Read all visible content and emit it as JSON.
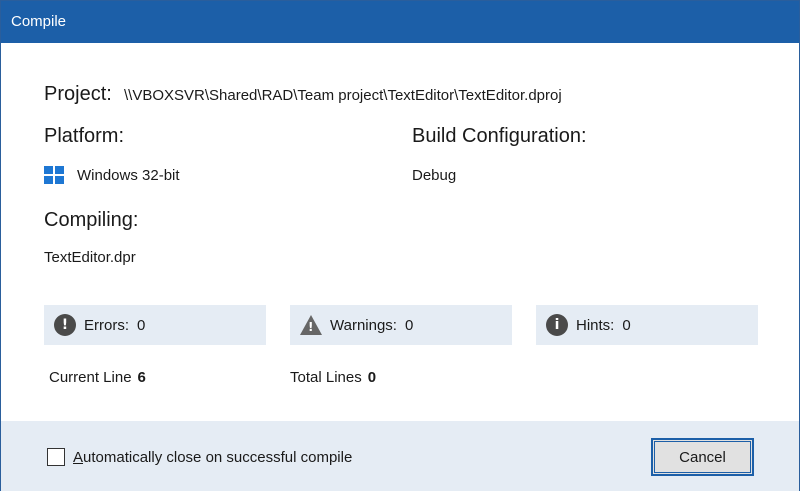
{
  "window": {
    "title": "Compile"
  },
  "project": {
    "label": "Project:",
    "path": "\\\\VBOXSVR\\Shared\\RAD\\Team project\\TextEditor\\TextEditor.dproj"
  },
  "platform": {
    "label": "Platform:",
    "value": "Windows 32-bit",
    "icon": "windows-logo-icon"
  },
  "build_config": {
    "label": "Build Configuration:",
    "value": "Debug"
  },
  "compiling": {
    "label": "Compiling:",
    "value": "TextEditor.dpr"
  },
  "stats": {
    "errors": {
      "label": "Errors:",
      "value": "0",
      "icon": "error-icon"
    },
    "warnings": {
      "label": "Warnings:",
      "value": "0",
      "icon": "warning-icon"
    },
    "hints": {
      "label": "Hints:",
      "value": "0",
      "icon": "info-icon"
    }
  },
  "lines": {
    "current_label": "Current Line",
    "current_value": "6",
    "total_label": "Total Lines",
    "total_value": "0"
  },
  "footer": {
    "auto_close_label_first": "A",
    "auto_close_label_rest": "utomatically close on successful compile",
    "auto_close_checked": false,
    "cancel_label": "Cancel"
  },
  "colors": {
    "titlebar": "#1c5fa8",
    "panel": "#e5ecf4",
    "accent": "#1e77d3"
  }
}
